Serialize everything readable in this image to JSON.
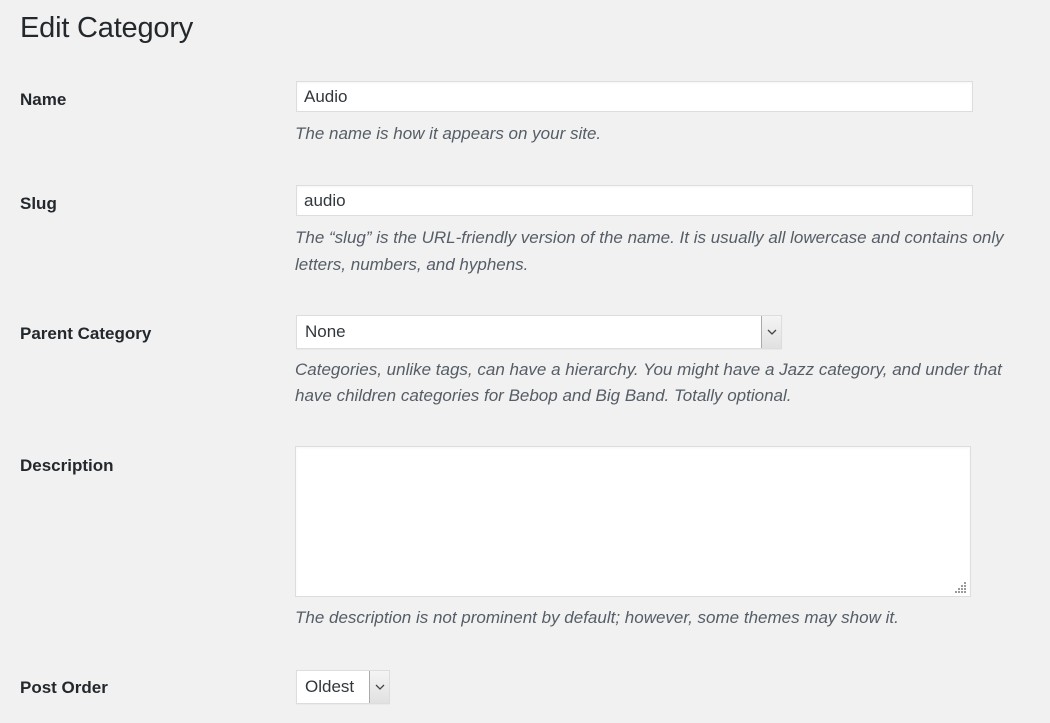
{
  "page": {
    "title": "Edit Category"
  },
  "form": {
    "name": {
      "label": "Name",
      "value": "Audio",
      "help": "The name is how it appears on your site."
    },
    "slug": {
      "label": "Slug",
      "value": "audio",
      "help_line1": "The “slug” is the URL-friendly version of the name. It is usually all lowercase and contains only",
      "help_line2": "letters, numbers, and hyphens."
    },
    "parent": {
      "label": "Parent Category",
      "selected": "None",
      "help_line1": "Categories, unlike tags, can have a hierarchy. You might have a Jazz category, and under that",
      "help_line2": "have children categories for Bebop and Big Band. Totally optional."
    },
    "description": {
      "label": "Description",
      "value": "",
      "help": "The description is not prominent by default; however, some themes may show it."
    },
    "post_order": {
      "label": "Post Order",
      "selected": "Oldest"
    }
  },
  "icons": {
    "select_arrow": "chevron-down-icon",
    "resize_grip": "resize-grip-icon"
  },
  "colors": {
    "background": "#f1f1f1",
    "text": "#23282d",
    "help_text": "#555d66",
    "border": "#dddddd"
  }
}
